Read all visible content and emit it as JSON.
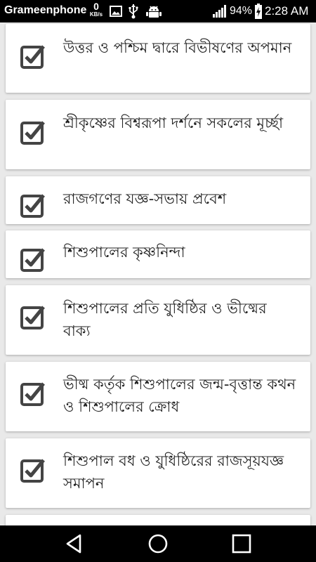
{
  "status_bar": {
    "carrier": "Grameenphone",
    "net_speed_value": "0",
    "net_speed_unit": "KB/s",
    "icons": [
      "image-icon",
      "usb-icon",
      "android-debug-icon",
      "signal-icon",
      "battery-icon"
    ],
    "battery_percent": "94%",
    "time": "2:28 AM"
  },
  "chapters": [
    {
      "title": "উত্তর ও পশ্চিম দ্বারে বিভীষণের অপমান",
      "checked": true
    },
    {
      "title": "শ্রীকৃষ্ণের বিশ্বরূপা দর্শনে সকলের মূর্চ্ছা",
      "checked": true
    },
    {
      "title": "রাজগণের যজ্ঞ-সভায় প্রবেশ",
      "checked": true
    },
    {
      "title": "শিশুপালের কৃষ্ণনিন্দা",
      "checked": true
    },
    {
      "title": "শিশুপালের প্রতি যুধিষ্ঠির ও ভীষ্মের বাক্য",
      "checked": true
    },
    {
      "title": "ভীষ্ম কর্তৃক শিশুপালের জন্ম-বৃত্তান্ত কথন ও শিশুপালের ক্রোধ",
      "checked": true
    },
    {
      "title": "শিশুপাল বধ ও যুধিষ্ঠিরের রাজসূয়যজ্ঞ সমাপন",
      "checked": true
    }
  ],
  "navigation": {
    "buttons": [
      "back-icon",
      "home-icon",
      "recents-icon"
    ]
  },
  "colors": {
    "status_bar": "#000000",
    "navigation_bar": "#000000",
    "list_background": "#e9e9e9",
    "card": "#ffffff",
    "checkbox": "#444444",
    "text": "#222222"
  }
}
